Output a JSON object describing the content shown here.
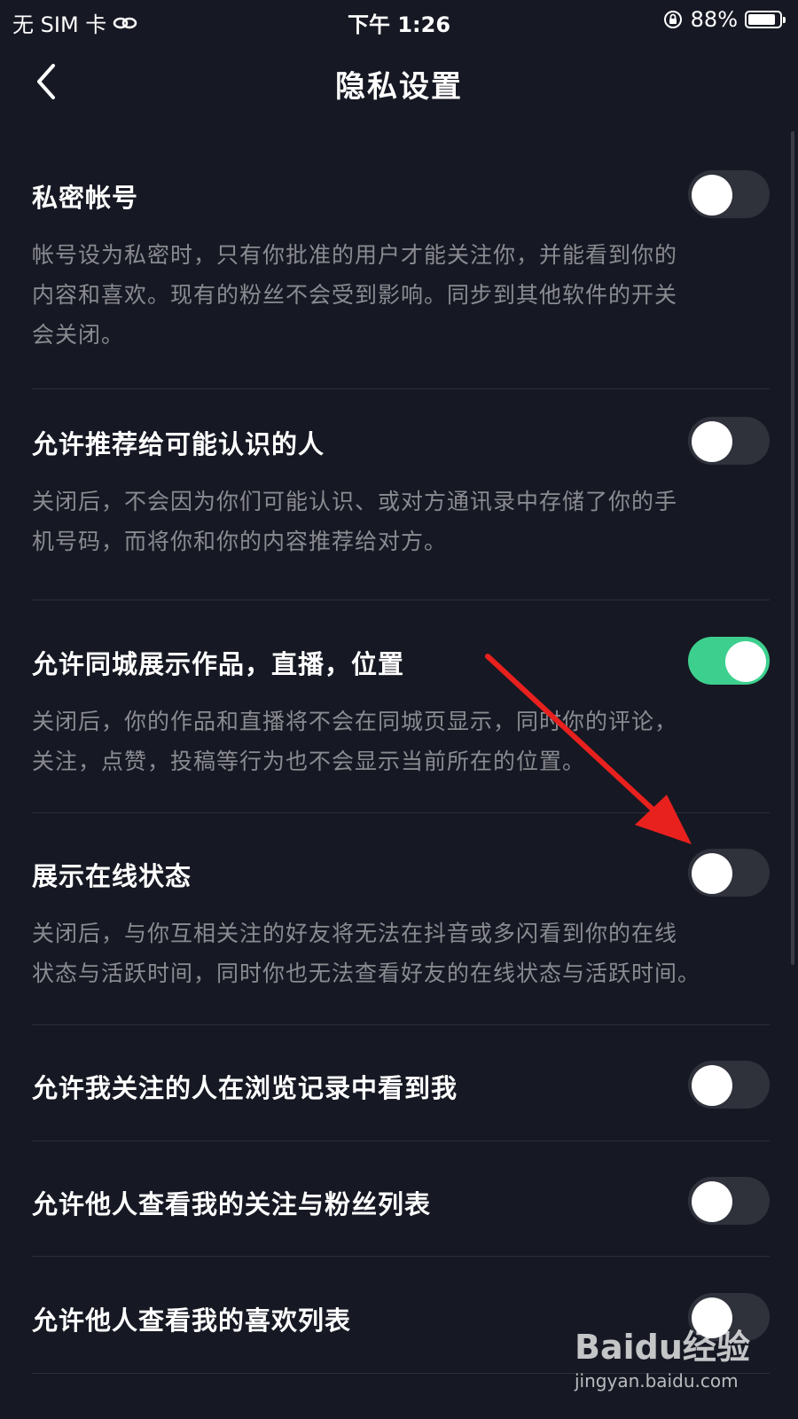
{
  "status_bar": {
    "carrier": "无 SIM 卡",
    "time": "下午 1:26",
    "battery": "88%",
    "battery_level": 0.88
  },
  "nav": {
    "back_icon": "chevron-left-icon",
    "title": "隐私设置"
  },
  "settings": [
    {
      "title": "私密帐号",
      "desc_lines": [
        "帐号设为私密时，只有你批准的用户才能关注你，并能看到你的",
        "内容和喜欢。现有的粉丝不会受到影响。同步到其他软件的开关",
        "会关闭。"
      ],
      "enabled": false
    },
    {
      "title": "允许推荐给可能认识的人",
      "desc_lines": [
        "关闭后，不会因为你们可能认识、或对方通讯录中存储了你的手",
        "机号码，而将你和你的内容推荐给对方。"
      ],
      "enabled": false
    },
    {
      "title": "允许同城展示作品，直播，位置",
      "desc_lines": [
        "关闭后，你的作品和直播将不会在同城页显示，同时你的评论，",
        "关注，点赞，投稿等行为也不会显示当前所在的位置。"
      ],
      "enabled": true
    },
    {
      "title": "展示在线状态",
      "desc_lines": [
        "关闭后，与你互相关注的好友将无法在抖音或多闪看到你的在线",
        "状态与活跃时间，同时你也无法查看好友的在线状态与活跃时间。"
      ],
      "enabled": false
    },
    {
      "title": "允许我关注的人在浏览记录中看到我",
      "enabled": false
    },
    {
      "title": "允许他人查看我的关注与粉丝列表",
      "enabled": false
    },
    {
      "title": "允许他人查看我的喜欢列表",
      "enabled": false
    }
  ],
  "colors": {
    "background": "#161823",
    "toggle_on": "#3dcf8e",
    "toggle_off": "#2f313b",
    "annotation_arrow": "#e8211e"
  },
  "watermark": {
    "logo": "Baidu经验",
    "url": "jingyan.baidu.com"
  }
}
